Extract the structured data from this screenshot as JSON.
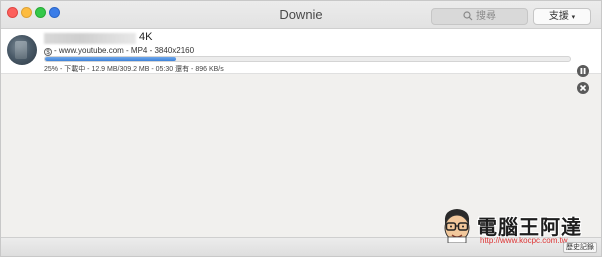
{
  "window": {
    "title": "Downie"
  },
  "toolbar": {
    "search_placeholder": "搜尋",
    "support_label": "支援",
    "support_chevron": "▾"
  },
  "download": {
    "title_suffix": "4K",
    "meta": "- www.youtube.com - MP4 - 3840x2160",
    "progress_fraction": 0.25,
    "status": "25% - 下載中 - 12.9 MB/309.2 MB - 05:30 還有 - 896 KB/s",
    "pause_icon": "pause-icon",
    "cancel_icon": "close-icon"
  },
  "watermark": {
    "title": "電腦王阿達",
    "url": "http://www.kocpc.com.tw"
  },
  "footer": {
    "history_label": "歷史記錄"
  },
  "colors": {
    "progress": "#3e83d9",
    "watermark_url": "#dd3333"
  }
}
